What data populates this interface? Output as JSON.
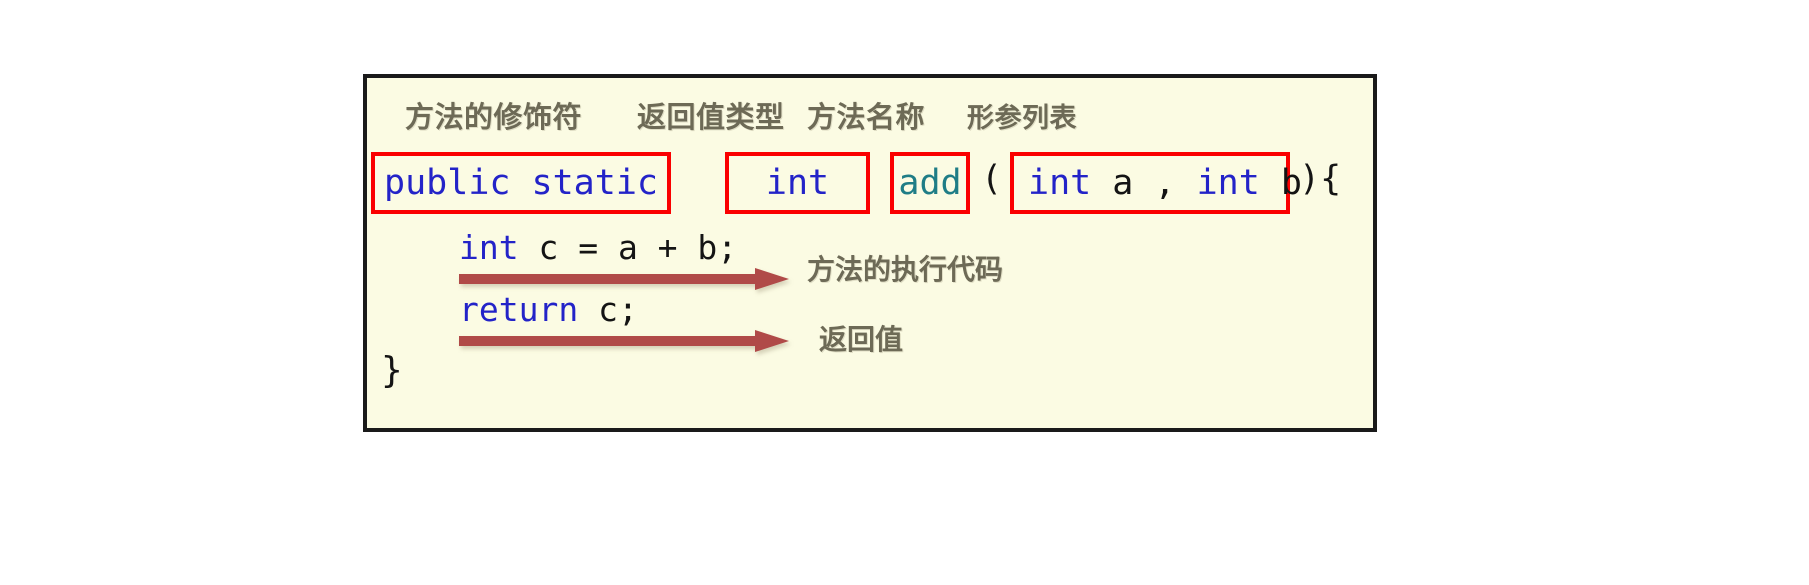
{
  "diagram": {
    "title": "Java method declaration anatomy",
    "background_color": "#fbfbe3",
    "frame_color": "#1a1a1a",
    "highlight_box_color": "#fa0000",
    "arrow_color": "#b04a48",
    "annotation_color": "#6d6a56",
    "labels": {
      "modifier": "方法的修饰符",
      "return_type": "返回值类型",
      "method_name": "方法名称",
      "parameter_list": "形参列表"
    },
    "signature": {
      "modifier": "public static",
      "return_type": "int",
      "method_name": "add",
      "paren_open": "(",
      "parameters": "int a , int b",
      "tail": "){"
    },
    "body": {
      "statement_1": "int c = a + b;",
      "statement_1_keyword": "int",
      "statement_1_rest": " c = a + b;",
      "statement_2": "return c;",
      "statement_2_keyword": "return",
      "statement_2_rest": " c;",
      "closing_brace": "}"
    },
    "annotations": {
      "body_note": "方法的执行代码",
      "return_note": "返回值"
    }
  }
}
